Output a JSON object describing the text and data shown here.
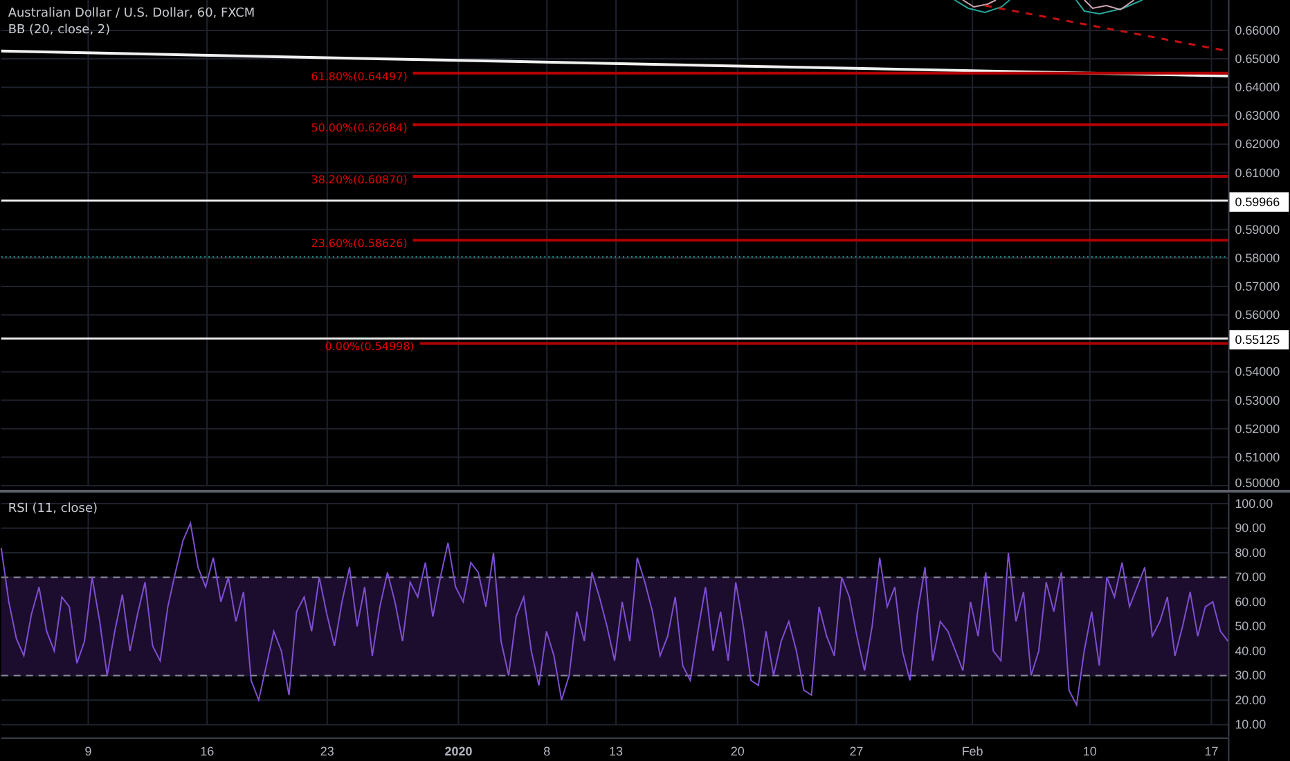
{
  "chart": {
    "title": "Australian Dollar / U.S. Dollar, 60, FXCM",
    "indicator": "BB (20, close, 2)",
    "fib_levels": [
      {
        "label": "61.80%(0.64497)"
      },
      {
        "label": "50.00%(0.62684)"
      },
      {
        "label": "38.20%(0.60870)"
      },
      {
        "label": "23.60%(0.58626)"
      },
      {
        "label": "0.00%(0.54998)"
      }
    ],
    "price_labels": [
      {
        "text": "0.59966"
      },
      {
        "text": "0.55125"
      }
    ],
    "price_ticks": [
      "0.66000",
      "0.65000",
      "0.64000",
      "0.63000",
      "0.62000",
      "0.61000",
      "0.59000",
      "0.58000",
      "0.57000",
      "0.56000",
      "0.54000",
      "0.53000",
      "0.52000",
      "0.51000",
      "0.50000"
    ]
  },
  "rsi": {
    "title": "RSI (11, close)",
    "chart_data": {
      "type": "line",
      "ylim": [
        10,
        100
      ],
      "yticks": [
        {
          "value": 100,
          "label": "100.00"
        },
        {
          "value": 90,
          "label": "90.00"
        },
        {
          "value": 80,
          "label": "80.00"
        },
        {
          "value": 70,
          "label": "70.00"
        },
        {
          "value": 60,
          "label": "60.00"
        },
        {
          "value": 50,
          "label": "50.00"
        },
        {
          "value": 40,
          "label": "40.00"
        },
        {
          "value": 30,
          "label": "30.00"
        },
        {
          "value": 20,
          "label": "20.00"
        },
        {
          "value": 10,
          "label": "10.00"
        }
      ],
      "grid": true,
      "bands": [
        {
          "axis": "y",
          "from": 30,
          "to": 70,
          "color": "#1c0d2e"
        }
      ],
      "series": [
        {
          "color": "#7e4fd0",
          "values": [
            82,
            60,
            45,
            38,
            55,
            66,
            48,
            40,
            62,
            58,
            35,
            44,
            70,
            52,
            30,
            48,
            63,
            40,
            55,
            68,
            42,
            36,
            58,
            72,
            85,
            92,
            74,
            66,
            78,
            60,
            70,
            52,
            64,
            28,
            20,
            34,
            48,
            40,
            22,
            56,
            62,
            48,
            70,
            55,
            42,
            60,
            74,
            50,
            66,
            38,
            58,
            72,
            60,
            44,
            68,
            62,
            76,
            54,
            70,
            84,
            66,
            60,
            76,
            72,
            58,
            80,
            44,
            30,
            54,
            62,
            40,
            26,
            48,
            38,
            20,
            30,
            56,
            44,
            72,
            62,
            50,
            36,
            60,
            44,
            78,
            68,
            56,
            38,
            46,
            62,
            34,
            28,
            48,
            66,
            40,
            56,
            36,
            68,
            50,
            28,
            26,
            48,
            30,
            44,
            52,
            40,
            24,
            22,
            58,
            46,
            38,
            70,
            62,
            46,
            32,
            50,
            78,
            58,
            66,
            40,
            28,
            56,
            74,
            36,
            52,
            48,
            40,
            32,
            60,
            46,
            72,
            40,
            36,
            80,
            52,
            64,
            30,
            40,
            68,
            56,
            72,
            24,
            18,
            40,
            56,
            34,
            70,
            62,
            76,
            58,
            66,
            74,
            46,
            52,
            62,
            38,
            50,
            64,
            46,
            58,
            60,
            48,
            44
          ]
        }
      ]
    }
  },
  "time_axis": {
    "ticks": [
      {
        "label": "9",
        "kind": "day"
      },
      {
        "label": "16",
        "kind": "day"
      },
      {
        "label": "23",
        "kind": "day"
      },
      {
        "label": "2020",
        "kind": "year"
      },
      {
        "label": "8",
        "kind": "day"
      },
      {
        "label": "13",
        "kind": "day"
      },
      {
        "label": "20",
        "kind": "day"
      },
      {
        "label": "27",
        "kind": "day"
      },
      {
        "label": "Feb",
        "kind": "month"
      },
      {
        "label": "10",
        "kind": "day"
      },
      {
        "label": "17",
        "kind": "day"
      }
    ]
  }
}
